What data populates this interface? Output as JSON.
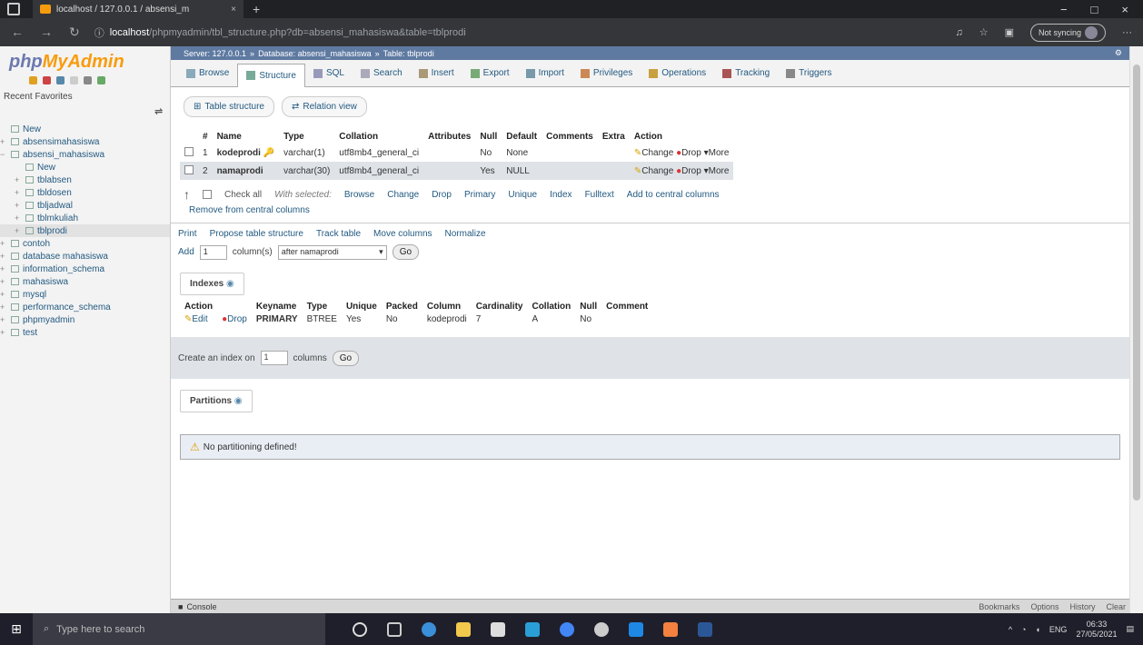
{
  "browser": {
    "tab_title": "localhost / 127.0.0.1 / absensi_m",
    "tab_close": "×",
    "new_tab": "+",
    "window_controls": [
      "−",
      "□",
      "×"
    ],
    "url_host": "localhost",
    "url_path": "/phpmyadmin/tbl_structure.php?db=absensi_mahasiswa&table=tblprodi",
    "sync_label": "Not syncing"
  },
  "sidebar": {
    "logo_a": "php",
    "logo_b": "MyAdmin",
    "tabs": "Recent  Favorites",
    "collapse": "⇌",
    "tree": [
      {
        "label": "New",
        "exp": "",
        "child": false,
        "sel": false
      },
      {
        "label": "absensimahasiswa",
        "exp": "+",
        "child": false,
        "sel": false
      },
      {
        "label": "absensi_mahasiswa",
        "exp": "−",
        "child": false,
        "sel": false
      },
      {
        "label": "New",
        "exp": "",
        "child": true,
        "sel": false
      },
      {
        "label": "tblabsen",
        "exp": "+",
        "child": true,
        "sel": false
      },
      {
        "label": "tbldosen",
        "exp": "+",
        "child": true,
        "sel": false
      },
      {
        "label": "tbljadwal",
        "exp": "+",
        "child": true,
        "sel": false
      },
      {
        "label": "tblmkuliah",
        "exp": "+",
        "child": true,
        "sel": false
      },
      {
        "label": "tblprodi",
        "exp": "+",
        "child": true,
        "sel": true
      },
      {
        "label": "contoh",
        "exp": "+",
        "child": false,
        "sel": false
      },
      {
        "label": "database mahasiswa",
        "exp": "+",
        "child": false,
        "sel": false
      },
      {
        "label": "information_schema",
        "exp": "+",
        "child": false,
        "sel": false
      },
      {
        "label": "mahasiswa",
        "exp": "+",
        "child": false,
        "sel": false
      },
      {
        "label": "mysql",
        "exp": "+",
        "child": false,
        "sel": false
      },
      {
        "label": "performance_schema",
        "exp": "+",
        "child": false,
        "sel": false
      },
      {
        "label": "phpmyadmin",
        "exp": "+",
        "child": false,
        "sel": false
      },
      {
        "label": "test",
        "exp": "+",
        "child": false,
        "sel": false
      }
    ]
  },
  "breadcrumb": {
    "server": "Server: 127.0.0.1",
    "database": "Database: absensi_mahasiswa",
    "table": "Table: tblprodi",
    "sep": "»"
  },
  "menu": [
    {
      "label": "Browse",
      "active": false
    },
    {
      "label": "Structure",
      "active": true
    },
    {
      "label": "SQL",
      "active": false
    },
    {
      "label": "Search",
      "active": false
    },
    {
      "label": "Insert",
      "active": false
    },
    {
      "label": "Export",
      "active": false
    },
    {
      "label": "Import",
      "active": false
    },
    {
      "label": "Privileges",
      "active": false
    },
    {
      "label": "Operations",
      "active": false
    },
    {
      "label": "Tracking",
      "active": false
    },
    {
      "label": "Triggers",
      "active": false
    }
  ],
  "subtabs": {
    "structure": "Table structure",
    "relation": "Relation view"
  },
  "structure": {
    "headers": [
      "#",
      "Name",
      "Type",
      "Collation",
      "Attributes",
      "Null",
      "Default",
      "Comments",
      "Extra",
      "Action"
    ],
    "rows": [
      {
        "num": "1",
        "name": "kodeprodi",
        "type": "varchar(1)",
        "collation": "utf8mb4_general_ci",
        "attributes": "",
        "null": "No",
        "default": "None",
        "comments": "",
        "extra": ""
      },
      {
        "num": "2",
        "name": "namaprodi",
        "type": "varchar(30)",
        "collation": "utf8mb4_general_ci",
        "attributes": "",
        "null": "Yes",
        "default": "NULL",
        "comments": "",
        "extra": ""
      }
    ],
    "actions": {
      "change": "Change",
      "drop": "Drop",
      "more": "More"
    }
  },
  "with_selected": {
    "arrow": "↑",
    "check_all": "Check all",
    "label": "With selected:",
    "browse": "Browse",
    "change": "Change",
    "drop": "Drop",
    "primary": "Primary",
    "unique": "Unique",
    "index": "Index",
    "fulltext": "Fulltext",
    "add_central": "Add to central columns",
    "remove_central": "Remove from central columns"
  },
  "tools": {
    "print": "Print",
    "propose": "Propose table structure",
    "track": "Track table",
    "move": "Move columns",
    "normalize": "Normalize"
  },
  "add_columns": {
    "label": "Add",
    "count": "1",
    "suffix": "column(s)",
    "position": "after namaprodi",
    "go": "Go"
  },
  "indexes": {
    "legend": "Indexes",
    "headers": [
      "Action",
      "",
      "Keyname",
      "Type",
      "Unique",
      "Packed",
      "Column",
      "Cardinality",
      "Collation",
      "Null",
      "Comment"
    ],
    "row": {
      "edit": "Edit",
      "drop": "Drop",
      "keyname": "PRIMARY",
      "type": "BTREE",
      "unique": "Yes",
      "packed": "No",
      "column": "kodeprodi",
      "cardinality": "7",
      "collation": "A",
      "null": "No",
      "comment": ""
    }
  },
  "create_index": {
    "label": "Create an index on",
    "count": "1",
    "suffix": "columns",
    "go": "Go"
  },
  "partitions": {
    "legend": "Partitions",
    "notice": "No partitioning defined!"
  },
  "console": {
    "label": "Console",
    "links": [
      "Bookmarks",
      "Options",
      "History",
      "Clear"
    ]
  },
  "taskbar": {
    "search_placeholder": "Type here to search",
    "lang": "ENG",
    "time": "06:33",
    "date": "27/05/2021"
  }
}
